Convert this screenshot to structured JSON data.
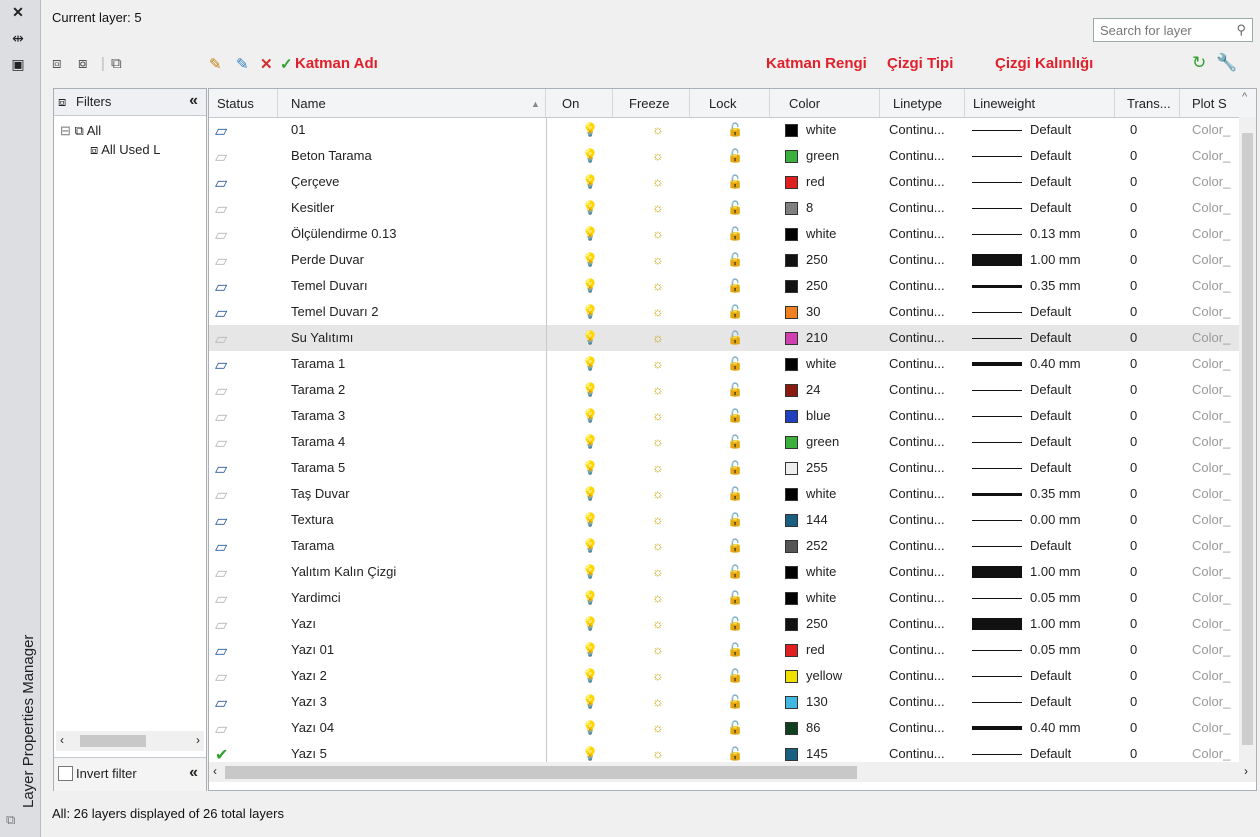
{
  "app": {
    "vertical_title": "Layer Properties Manager"
  },
  "header": {
    "current_layer": "Current layer: 5",
    "search_placeholder": "Search for layer"
  },
  "annotations": {
    "name": "Katman Adı",
    "color": "Katman Rengi",
    "linetype": "Çizgi Tipi",
    "lineweight": "Çizgi Kalınlığı"
  },
  "filters": {
    "header": "Filters",
    "tree_all": "All",
    "tree_used": "All Used L",
    "invert": "Invert filter"
  },
  "columns": {
    "status": "Status",
    "name": "Name",
    "on": "On",
    "freeze": "Freeze",
    "lock": "Lock",
    "color": "Color",
    "linetype": "Linetype",
    "lineweight": "Lineweight",
    "trans": "Trans...",
    "plot": "Plot S"
  },
  "layers": [
    {
      "name": "01",
      "color": "white",
      "hex": "#000000",
      "lt": "Continu...",
      "lw": "Default",
      "lwt": 1,
      "tr": "0",
      "ps": "Color_",
      "st": "used"
    },
    {
      "name": "Beton Tarama",
      "color": "green",
      "hex": "#3cb03c",
      "lt": "Continu...",
      "lw": "Default",
      "lwt": 1,
      "tr": "0",
      "ps": "Color_",
      "st": "empty"
    },
    {
      "name": "Çerçeve",
      "color": "red",
      "hex": "#e02020",
      "lt": "Continu...",
      "lw": "Default",
      "lwt": 1,
      "tr": "0",
      "ps": "Color_",
      "st": "used"
    },
    {
      "name": "Kesitler",
      "color": "8",
      "hex": "#808080",
      "lt": "Continu...",
      "lw": "Default",
      "lwt": 1,
      "tr": "0",
      "ps": "Color_",
      "st": "empty"
    },
    {
      "name": "Ölçülendirme 0.13",
      "color": "white",
      "hex": "#000000",
      "lt": "Continu...",
      "lw": "0.13 mm",
      "lwt": 1,
      "tr": "0",
      "ps": "Color_",
      "st": "empty"
    },
    {
      "name": "Perde Duvar",
      "color": "250",
      "hex": "#111111",
      "lt": "Continu...",
      "lw": "1.00 mm",
      "lwt": 12,
      "tr": "0",
      "ps": "Color_",
      "st": "empty"
    },
    {
      "name": "Temel Duvarı",
      "color": "250",
      "hex": "#111111",
      "lt": "Continu...",
      "lw": "0.35 mm",
      "lwt": 3,
      "tr": "0",
      "ps": "Color_",
      "st": "used"
    },
    {
      "name": "Temel Duvarı 2",
      "color": "30",
      "hex": "#f08020",
      "lt": "Continu...",
      "lw": "Default",
      "lwt": 1,
      "tr": "0",
      "ps": "Color_",
      "st": "used"
    },
    {
      "name": "Su Yalıtımı",
      "color": "210",
      "hex": "#d040b0",
      "lt": "Continu...",
      "lw": "Default",
      "lwt": 1,
      "tr": "0",
      "ps": "Color_",
      "st": "empty",
      "hl": true
    },
    {
      "name": "Tarama 1",
      "color": "white",
      "hex": "#000000",
      "lt": "Continu...",
      "lw": "0.40 mm",
      "lwt": 4,
      "tr": "0",
      "ps": "Color_",
      "st": "used"
    },
    {
      "name": "Tarama 2",
      "color": "24",
      "hex": "#8a1a10",
      "lt": "Continu...",
      "lw": "Default",
      "lwt": 1,
      "tr": "0",
      "ps": "Color_",
      "st": "empty"
    },
    {
      "name": "Tarama 3",
      "color": "blue",
      "hex": "#2040c0",
      "lt": "Continu...",
      "lw": "Default",
      "lwt": 1,
      "tr": "0",
      "ps": "Color_",
      "st": "empty"
    },
    {
      "name": "Tarama 4",
      "color": "green",
      "hex": "#3cb03c",
      "lt": "Continu...",
      "lw": "Default",
      "lwt": 1,
      "tr": "0",
      "ps": "Color_",
      "st": "empty"
    },
    {
      "name": "Tarama 5",
      "color": "255",
      "hex": "#eeeeee",
      "lt": "Continu...",
      "lw": "Default",
      "lwt": 1,
      "tr": "0",
      "ps": "Color_",
      "st": "used"
    },
    {
      "name": "Taş Duvar",
      "color": "white",
      "hex": "#000000",
      "lt": "Continu...",
      "lw": "0.35 mm",
      "lwt": 3,
      "tr": "0",
      "ps": "Color_",
      "st": "empty"
    },
    {
      "name": "Textura",
      "color": "144",
      "hex": "#1a5f80",
      "lt": "Continu...",
      "lw": "0.00 mm",
      "lwt": 1,
      "tr": "0",
      "ps": "Color_",
      "st": "used"
    },
    {
      "name": "Tarama",
      "color": "252",
      "hex": "#555555",
      "lt": "Continu...",
      "lw": "Default",
      "lwt": 1,
      "tr": "0",
      "ps": "Color_",
      "st": "used"
    },
    {
      "name": "Yalıtım Kalın Çizgi",
      "color": "white",
      "hex": "#000000",
      "lt": "Continu...",
      "lw": "1.00 mm",
      "lwt": 12,
      "tr": "0",
      "ps": "Color_",
      "st": "empty"
    },
    {
      "name": "Yardimci",
      "color": "white",
      "hex": "#000000",
      "lt": "Continu...",
      "lw": "0.05 mm",
      "lwt": 1,
      "tr": "0",
      "ps": "Color_",
      "st": "empty"
    },
    {
      "name": "Yazı",
      "color": "250",
      "hex": "#111111",
      "lt": "Continu...",
      "lw": "1.00 mm",
      "lwt": 12,
      "tr": "0",
      "ps": "Color_",
      "st": "empty"
    },
    {
      "name": "Yazı 01",
      "color": "red",
      "hex": "#e02020",
      "lt": "Continu...",
      "lw": "0.05 mm",
      "lwt": 1,
      "tr": "0",
      "ps": "Color_",
      "st": "used"
    },
    {
      "name": "Yazı 2",
      "color": "yellow",
      "hex": "#f0e000",
      "lt": "Continu...",
      "lw": "Default",
      "lwt": 1,
      "tr": "0",
      "ps": "Color_",
      "st": "empty"
    },
    {
      "name": "Yazı 3",
      "color": "130",
      "hex": "#40b8e0",
      "lt": "Continu...",
      "lw": "Default",
      "lwt": 1,
      "tr": "0",
      "ps": "Color_",
      "st": "used"
    },
    {
      "name": "Yazı 04",
      "color": "86",
      "hex": "#104020",
      "lt": "Continu...",
      "lw": "0.40 mm",
      "lwt": 4,
      "tr": "0",
      "ps": "Color_",
      "st": "empty"
    },
    {
      "name": "Yazı 5",
      "color": "145",
      "hex": "#1a6080",
      "lt": "Continu...",
      "lw": "Default",
      "lwt": 1,
      "tr": "0",
      "ps": "Color_",
      "st": "current"
    }
  ],
  "statusbar": "All: 26 layers displayed of 26 total layers"
}
